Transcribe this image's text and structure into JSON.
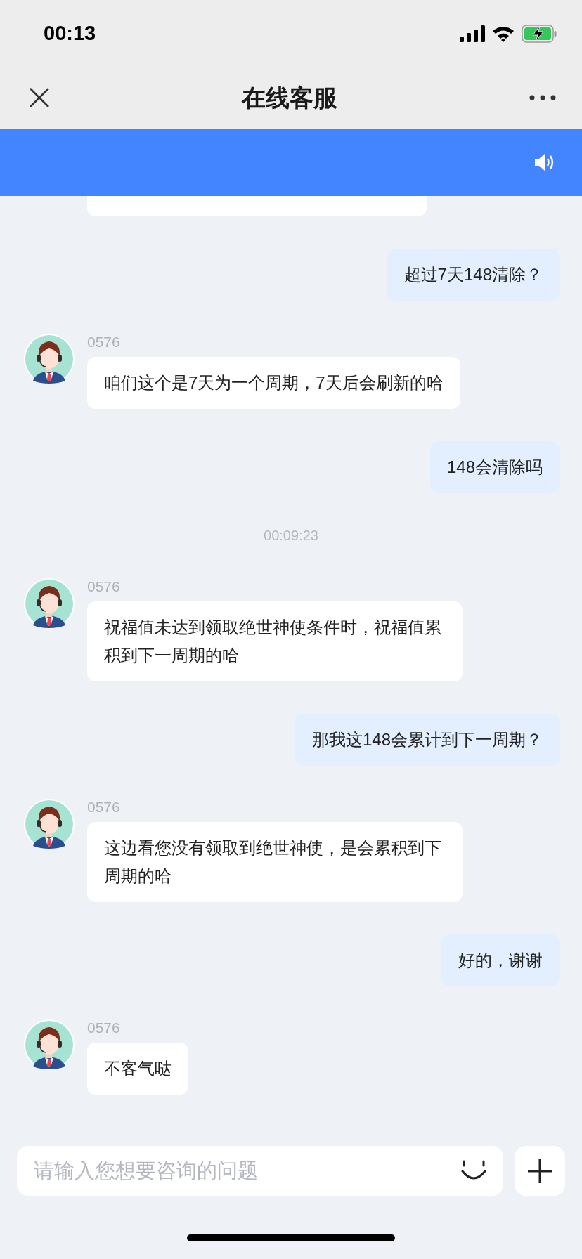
{
  "status_bar": {
    "time": "00:13"
  },
  "nav": {
    "title": "在线客服"
  },
  "messages": [
    {
      "kind": "clipped"
    },
    {
      "kind": "self",
      "text": "超过7天148清除？"
    },
    {
      "kind": "agent",
      "name": "0576",
      "text": "咱们这个是7天为一个周期，7天后会刷新的哈"
    },
    {
      "kind": "self",
      "text": "148会清除吗"
    },
    {
      "kind": "time",
      "text": "00:09:23"
    },
    {
      "kind": "agent",
      "name": "0576",
      "text": "祝福值未达到领取绝世神使条件时，祝福值累积到下一周期的哈"
    },
    {
      "kind": "self",
      "text": "那我这148会累计到下一周期？"
    },
    {
      "kind": "agent",
      "name": "0576",
      "text": "这边看您没有领取到绝世神使，是会累积到下周期的哈"
    },
    {
      "kind": "self",
      "text": "好的，谢谢"
    },
    {
      "kind": "agent",
      "name": "0576",
      "text": "不客气哒"
    }
  ],
  "composer": {
    "placeholder": "请输入您想要咨询的问题"
  }
}
